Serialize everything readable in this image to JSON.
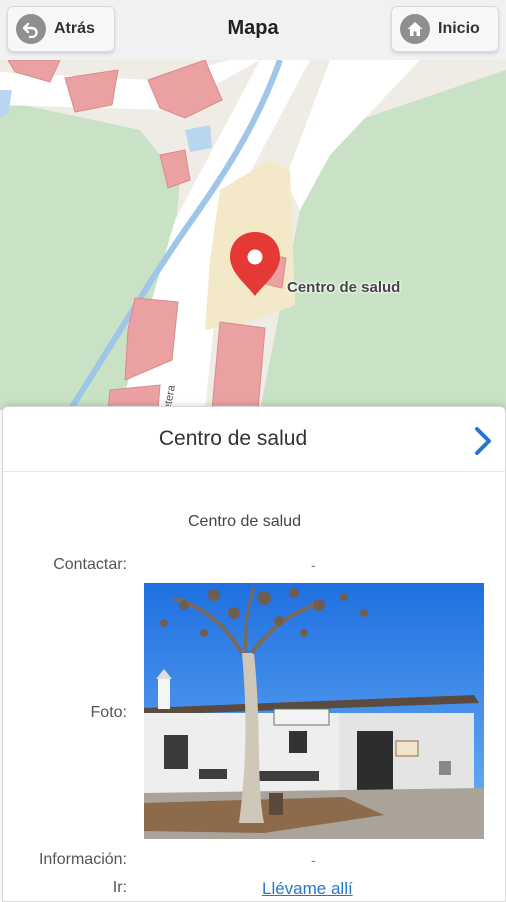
{
  "header": {
    "back_label": "Atrás",
    "title": "Mapa",
    "home_label": "Inicio"
  },
  "map": {
    "poi_label": "Centro de salud",
    "road_label": "Carretera"
  },
  "panel": {
    "title": "Centro de salud",
    "subtitle": "Centro de salud",
    "rows": {
      "contact_label": "Contactar:",
      "contact_value": "-",
      "photo_label": "Foto:",
      "info_label": "Información:",
      "info_value": "-",
      "go_label": "Ir:",
      "go_link": "Llévame allí"
    }
  },
  "colors": {
    "accent": "#2477d0",
    "marker": "#e53935",
    "map_green": "#c9e2c5",
    "building": "#eba1a1"
  },
  "icons": {
    "back": "back-arrow-icon",
    "home": "home-icon",
    "marker": "map-marker-icon",
    "next": "chevron-right-icon"
  }
}
